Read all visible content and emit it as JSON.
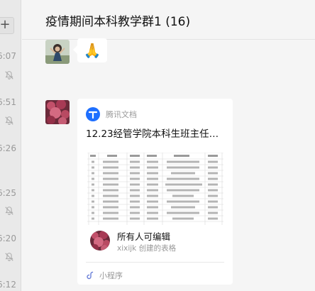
{
  "chat": {
    "title": "疫情期间本科教学群1 (16)"
  },
  "sidebar": {
    "plus_label": "+",
    "times": [
      "6:07",
      "6:51",
      "6:26",
      "6:25",
      "6:20",
      "6:12"
    ]
  },
  "messages": {
    "emoji": "🙏",
    "card": {
      "source": "腾讯文档",
      "title": "12.23经管学院本科生班主任、…",
      "permission": "所有人可编辑",
      "creator": "xixijk 创建的表格",
      "footer": "小程序"
    }
  },
  "colors": {
    "accent": "#1e6fff",
    "muted_text": "#999999",
    "background": "#f5f5f5"
  }
}
